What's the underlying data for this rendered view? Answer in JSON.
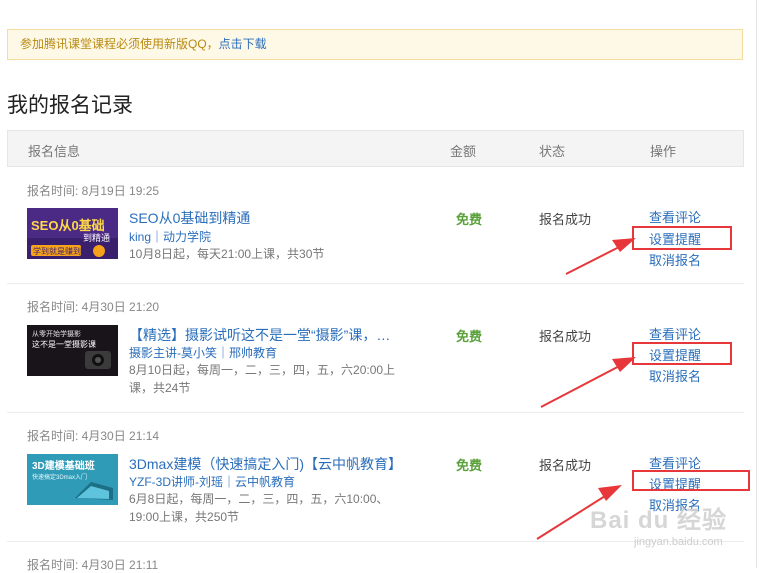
{
  "notice": {
    "text": "参加腾讯课堂课程必须使用新版QQ，",
    "link": "点击下载"
  },
  "page_title": "我的报名记录",
  "table_headers": {
    "info": "报名信息",
    "amount": "金额",
    "status": "状态",
    "ops": "操作"
  },
  "records": [
    {
      "time": "报名时间: 8月19日 19:25",
      "thumb_text": [
        "SEO从0基础",
        "到精通",
        "学到就是赚到"
      ],
      "title": "SEO从0基础到精通",
      "teacher": "king｜动力学院",
      "schedule": "10月8日起，每天21:00上课，共30节",
      "price": "免费",
      "status": "报名成功",
      "op_view": "查看评论",
      "op_remind": "设置提醒",
      "op_cancel": "取消报名"
    },
    {
      "time": "报名时间: 4月30日 21:20",
      "thumb_text": [
        "从零开始学摄影",
        "这不是一堂摄影课"
      ],
      "title": "【精选】摄影试听这不是一堂“摄影”课，…",
      "teacher": "摄影主讲-莫小笑｜邢帅教育",
      "schedule": "8月10日起，每周一，二，三，四，五，六20:00上课，共24节",
      "price": "免费",
      "status": "报名成功",
      "op_view": "查看评论",
      "op_remind": "设置提醒",
      "op_cancel": "取消报名"
    },
    {
      "time": "报名时间: 4月30日 21:14",
      "thumb_text": [
        "3D建模基础班",
        "快速搞定3Dmax入门"
      ],
      "title": "3Dmax建模（快速搞定入门)【云中帆教育】",
      "teacher": "YZF-3D讲师-刘瑶｜云中帆教育",
      "schedule": "6月8日起，每周一，二，三，四，五，六10:00、19:00上课，共250节",
      "price": "免费",
      "status": "报名成功",
      "op_view": "查看评论",
      "op_remind": "设置提醒",
      "op_cancel": "取消报名"
    },
    {
      "time": "报名时间: 4月30日 21:11"
    }
  ],
  "watermark": {
    "brand": "Bai du 经验",
    "url": "jingyan.baidu.com"
  },
  "colors": {
    "link": "#2a6ebb",
    "free": "#5aa13c",
    "highlight": "#e8373a",
    "notice_bg": "#fef9e7"
  }
}
